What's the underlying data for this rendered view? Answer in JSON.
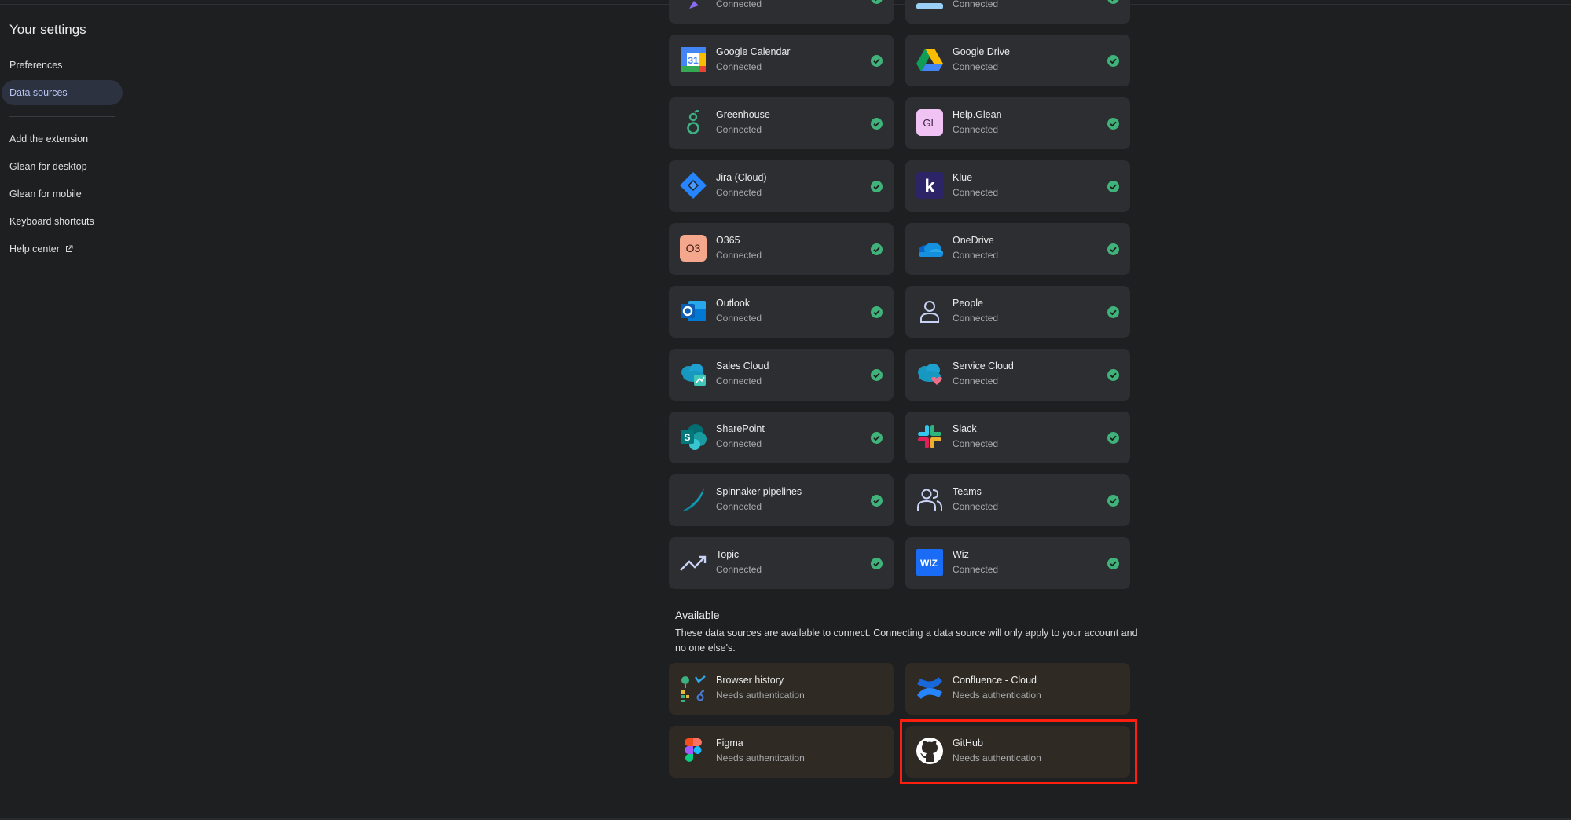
{
  "sidebar": {
    "title": "Your settings",
    "items": [
      {
        "label": "Preferences"
      },
      {
        "label": "Data sources",
        "active": true
      },
      {
        "label": "Add the extension"
      },
      {
        "label": "Glean for desktop"
      },
      {
        "label": "Glean for mobile"
      },
      {
        "label": "Keyboard shortcuts"
      },
      {
        "label": "Help center",
        "icon": "external-link-icon"
      }
    ]
  },
  "connected": {
    "partial_top": [
      {
        "status": "Connected"
      },
      {
        "status": "Connected"
      }
    ],
    "cards": [
      {
        "name": "Google Calendar",
        "status": "Connected",
        "icon": "google-calendar-icon"
      },
      {
        "name": "Google Drive",
        "status": "Connected",
        "icon": "google-drive-icon"
      },
      {
        "name": "Greenhouse",
        "status": "Connected",
        "icon": "greenhouse-icon"
      },
      {
        "name": "Help.Glean",
        "status": "Connected",
        "icon": "help-glean-icon",
        "icon_text": "GL"
      },
      {
        "name": "Jira (Cloud)",
        "status": "Connected",
        "icon": "jira-icon"
      },
      {
        "name": "Klue",
        "status": "Connected",
        "icon": "klue-icon",
        "icon_text": "k"
      },
      {
        "name": "O365",
        "status": "Connected",
        "icon": "o365-icon",
        "icon_text": "O3"
      },
      {
        "name": "OneDrive",
        "status": "Connected",
        "icon": "onedrive-icon"
      },
      {
        "name": "Outlook",
        "status": "Connected",
        "icon": "outlook-icon"
      },
      {
        "name": "People",
        "status": "Connected",
        "icon": "people-icon"
      },
      {
        "name": "Sales Cloud",
        "status": "Connected",
        "icon": "sales-cloud-icon"
      },
      {
        "name": "Service Cloud",
        "status": "Connected",
        "icon": "service-cloud-icon"
      },
      {
        "name": "SharePoint",
        "status": "Connected",
        "icon": "sharepoint-icon"
      },
      {
        "name": "Slack",
        "status": "Connected",
        "icon": "slack-icon"
      },
      {
        "name": "Spinnaker pipelines",
        "status": "Connected",
        "icon": "spinnaker-icon"
      },
      {
        "name": "Teams",
        "status": "Connected",
        "icon": "teams-icon"
      },
      {
        "name": "Topic",
        "status": "Connected",
        "icon": "trending-up-icon"
      },
      {
        "name": "Wiz",
        "status": "Connected",
        "icon": "wiz-icon",
        "icon_text": "WIZ"
      }
    ]
  },
  "available": {
    "title": "Available",
    "description": "These data sources are available to connect. Connecting a data source will only apply to your account and no one else's.",
    "cards": [
      {
        "name": "Browser history",
        "status": "Needs authentication",
        "icon": "browser-history-icon"
      },
      {
        "name": "Confluence - Cloud",
        "status": "Needs authentication",
        "icon": "confluence-icon"
      },
      {
        "name": "Figma",
        "status": "Needs authentication",
        "icon": "figma-icon"
      },
      {
        "name": "GitHub",
        "status": "Needs authentication",
        "icon": "github-icon",
        "highlighted": true
      }
    ]
  },
  "colors": {
    "background": "#1e1f21",
    "card": "#2d2e31",
    "card_available": "#2f2b24",
    "check_green": "#3fb37a",
    "highlight": "#ff1e10",
    "active_nav": "#b7c5f2"
  }
}
